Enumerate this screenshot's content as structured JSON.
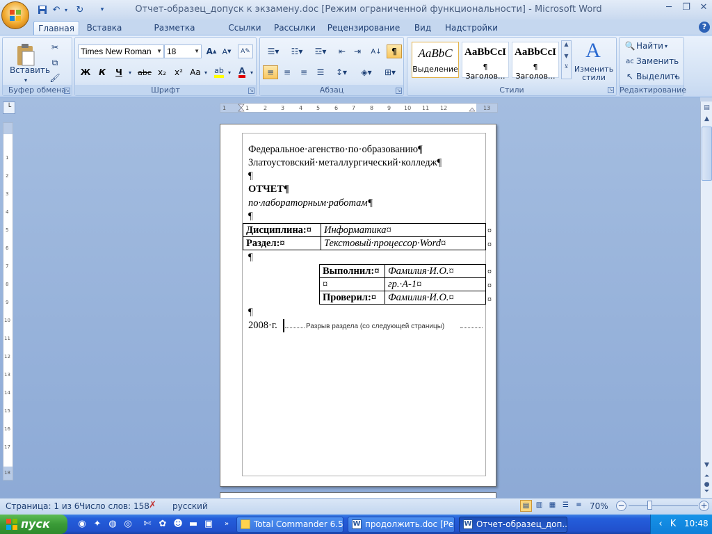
{
  "title_bar": {
    "document_title": "Отчет-образец_допуск к экзамену.doc [Режим ограниченной функциональности] - Microsoft Word",
    "minimize": "─",
    "restore": "❐",
    "close": "✕"
  },
  "tabs": [
    "Главная",
    "Вставка",
    "Разметка страницы",
    "Ссылки",
    "Рассылки",
    "Рецензирование",
    "Вид",
    "Надстройки"
  ],
  "ribbon": {
    "clipboard": {
      "label": "Буфер обмена",
      "paste": "Вставить"
    },
    "font": {
      "label": "Шрифт",
      "font_name": "Times New Roman",
      "font_size": "18",
      "bold": "Ж",
      "italic": "К",
      "underline": "Ч",
      "strike": "abc",
      "subscript": "x₂",
      "superscript": "x²",
      "case": "Aa"
    },
    "paragraph": {
      "label": "Абзац"
    },
    "styles": {
      "label": "Стили",
      "items": [
        {
          "sample": "AaBbC",
          "name": "Выделение"
        },
        {
          "sample": "AaBbCcI",
          "name": "¶ Заголов..."
        },
        {
          "sample": "AaBbCcI",
          "name": "¶ Заголов..."
        }
      ],
      "change_styles": "Изменить стили"
    },
    "editing": {
      "label": "Редактирование",
      "find": "Найти",
      "replace": "Заменить",
      "select": "Выделить"
    }
  },
  "document": {
    "lines": [
      "Федеральное·агенство·по·образованию¶",
      "Златоустовский·металлургический·колледж¶",
      "¶",
      "ОТЧЕТ¶",
      "по·лабораторным·работам¶",
      "¶"
    ],
    "table1": [
      [
        "Дисциплина:¤",
        "Информатика¤"
      ],
      [
        "Раздел:¤",
        "Текстовый·процессор·Word¤"
      ]
    ],
    "after_table1": "¶",
    "table2": [
      [
        "Выполнил:¤",
        "Фамилия·И.О.¤"
      ],
      [
        "¤",
        "гр.·А-1¤"
      ],
      [
        "Проверил:¤",
        "Фамилия·И.О.¤"
      ]
    ],
    "row_end_mark": "¤",
    "after_table2": "¶",
    "year_line": "2008·г.",
    "section_break": "Разрыв раздела (со следующей страницы)"
  },
  "status_bar": {
    "page": "Страница: 1 из 6",
    "words": "Число слов: 158",
    "language": "русский",
    "zoom": "70%"
  },
  "taskbar": {
    "start": "пуск",
    "tasks": [
      "Total Commander 6.5...",
      "продолжить.doc [Ре...",
      "Отчет-образец_доп..."
    ],
    "clock": "10:48"
  },
  "colors": {
    "ribbon": "#d2e1f4",
    "taskbar": "#245edb",
    "start": "#3a9b37"
  }
}
